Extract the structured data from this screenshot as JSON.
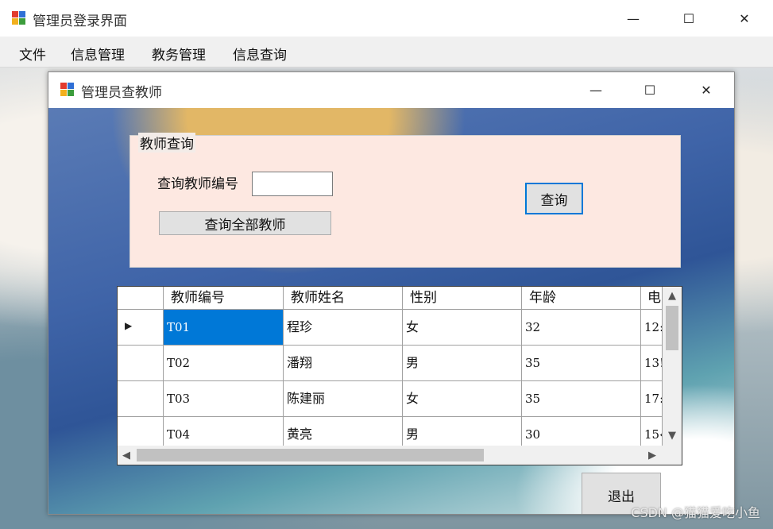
{
  "main_window": {
    "title": "管理员登录界面",
    "controls": {
      "minimize": "—",
      "maximize": "☐",
      "close": "✕"
    }
  },
  "menu": {
    "items": [
      {
        "label": "文件"
      },
      {
        "label": "信息管理"
      },
      {
        "label": "教务管理"
      },
      {
        "label": "信息查询"
      }
    ]
  },
  "child_window": {
    "title": "管理员查教师",
    "controls": {
      "minimize": "—",
      "maximize": "☐",
      "close": "✕"
    }
  },
  "query_group": {
    "title": "教师查询",
    "id_label": "查询教师编号",
    "id_value": "",
    "query_button": "查询",
    "query_all_button": "查询全部教师"
  },
  "grid": {
    "columns": [
      "教师编号",
      "教师姓名",
      "性别",
      "年龄",
      "电"
    ],
    "rows": [
      {
        "id": "T01",
        "name": "程珍",
        "gender": "女",
        "age": "32",
        "phone": "12:"
      },
      {
        "id": "T02",
        "name": "潘翔",
        "gender": "男",
        "age": "35",
        "phone": "13!"
      },
      {
        "id": "T03",
        "name": "陈建丽",
        "gender": "女",
        "age": "35",
        "phone": "17:"
      },
      {
        "id": "T04",
        "name": "黄亮",
        "gender": "男",
        "age": "30",
        "phone": "15‹"
      }
    ],
    "current_row_marker": "▶",
    "scroll_icons": {
      "up": "▲",
      "down": "▼",
      "left": "◀",
      "right": "▶"
    }
  },
  "exit_button": "退出",
  "watermark": "CSDN @猫猫爱吃小鱼"
}
